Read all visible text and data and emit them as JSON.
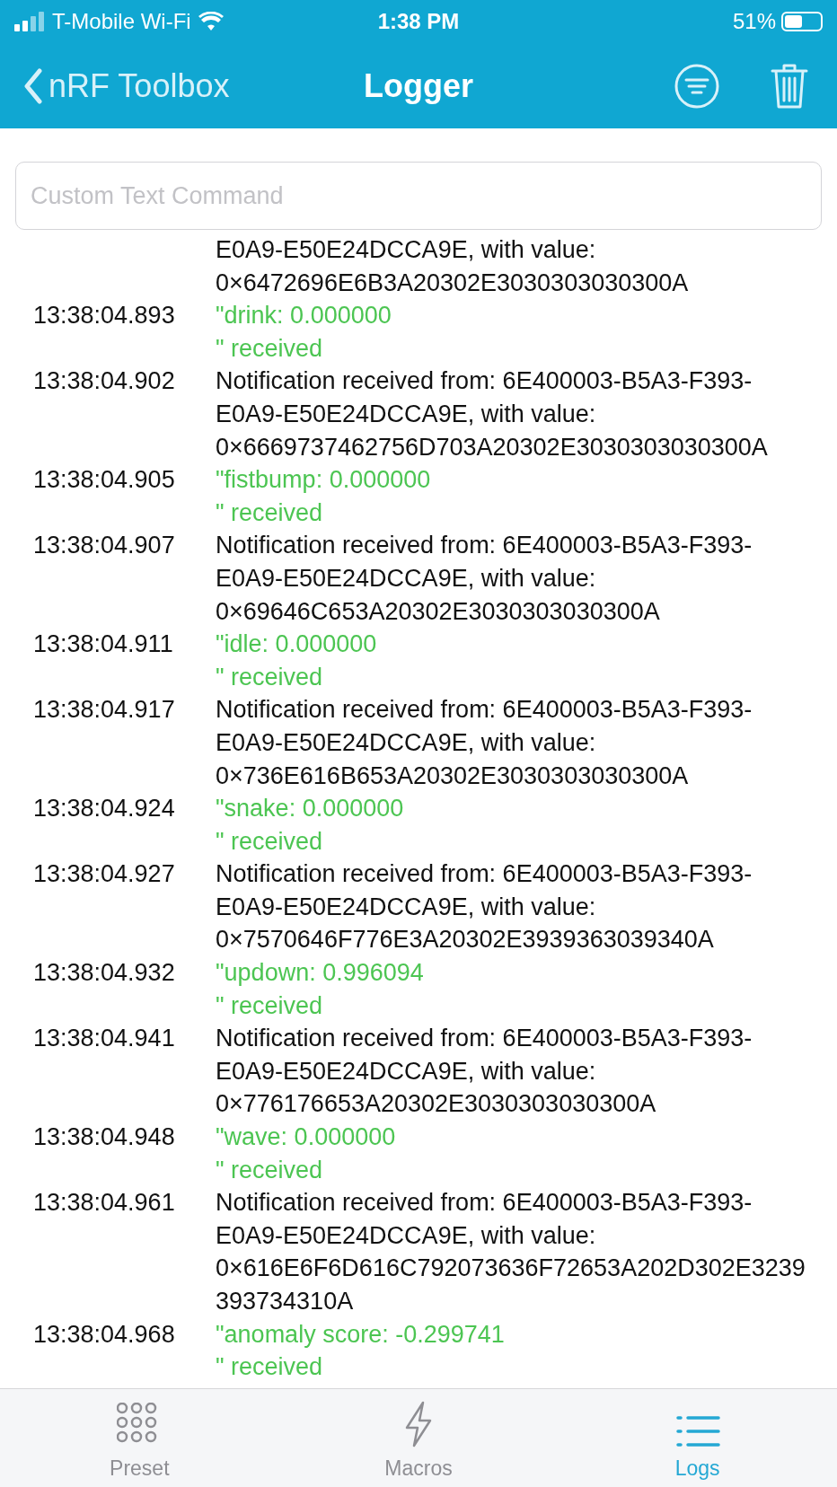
{
  "status_bar": {
    "carrier": "T-Mobile Wi-Fi",
    "time": "1:38 PM",
    "battery": "51%"
  },
  "nav_bar": {
    "back": "nRF Toolbox",
    "title": "Logger"
  },
  "command_field": {
    "placeholder": "Custom Text Command"
  },
  "log": [
    {
      "kind": "info",
      "lines": [
        "E0A9-E50E24DCCA9E, with value:",
        "0×6472696E6B3A20302E3030303030300A"
      ]
    },
    {
      "time": "13:38:04.893",
      "kind": "application",
      "lines": [
        "\"drink: 0.000000",
        "\" received"
      ]
    },
    {
      "time": "13:38:04.902",
      "kind": "info",
      "lines": [
        "Notification received from: 6E400003-B5A3-F393-",
        "E0A9-E50E24DCCA9E, with value:",
        "0×6669737462756D703A20302E3030303030300A"
      ]
    },
    {
      "time": "13:38:04.905",
      "kind": "application",
      "lines": [
        "\"fistbump: 0.000000",
        "\" received"
      ]
    },
    {
      "time": "13:38:04.907",
      "kind": "info",
      "lines": [
        "Notification received from: 6E400003-B5A3-F393-",
        "E0A9-E50E24DCCA9E, with value:",
        "0×69646C653A20302E3030303030300A"
      ]
    },
    {
      "time": "13:38:04.911",
      "kind": "application",
      "lines": [
        "\"idle: 0.000000",
        "\" received"
      ]
    },
    {
      "time": "13:38:04.917",
      "kind": "info",
      "lines": [
        "Notification received from: 6E400003-B5A3-F393-",
        "E0A9-E50E24DCCA9E, with value:",
        "0×736E616B653A20302E3030303030300A"
      ]
    },
    {
      "time": "13:38:04.924",
      "kind": "application",
      "lines": [
        "\"snake: 0.000000",
        "\" received"
      ]
    },
    {
      "time": "13:38:04.927",
      "kind": "info",
      "lines": [
        "Notification received from: 6E400003-B5A3-F393-",
        "E0A9-E50E24DCCA9E, with value:",
        "0×7570646F776E3A20302E3939363039340A"
      ]
    },
    {
      "time": "13:38:04.932",
      "kind": "application",
      "lines": [
        "\"updown: 0.996094",
        "\" received"
      ]
    },
    {
      "time": "13:38:04.941",
      "kind": "info",
      "lines": [
        "Notification received from: 6E400003-B5A3-F393-",
        "E0A9-E50E24DCCA9E, with value:",
        "0×776176653A20302E3030303030300A"
      ]
    },
    {
      "time": "13:38:04.948",
      "kind": "application",
      "lines": [
        "\"wave: 0.000000",
        "\" received"
      ]
    },
    {
      "time": "13:38:04.961",
      "kind": "info",
      "lines": [
        "Notification received from: 6E400003-B5A3-F393-",
        "E0A9-E50E24DCCA9E, with value:",
        "0×616E6F6D616C792073636F72653A202D302E3239",
        "393734310A"
      ]
    },
    {
      "time": "13:38:04.968",
      "kind": "application",
      "lines": [
        "\"anomaly score: -0.299741",
        "\" received"
      ]
    }
  ],
  "tabs": [
    {
      "label": "Preset",
      "kind": "grid",
      "selected": false
    },
    {
      "label": "Macros",
      "kind": "bolt",
      "selected": false
    },
    {
      "label": "Logs",
      "kind": "list",
      "selected": true
    }
  ]
}
